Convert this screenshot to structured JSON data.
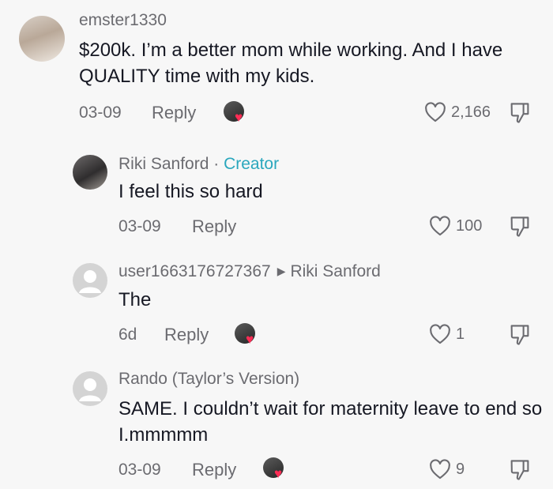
{
  "comments": [
    {
      "username": "emster1330",
      "text": "$200k. I’m a better mom while working. And I have QUALITY time with my kids.",
      "date": "03-09",
      "reply_label": "Reply",
      "likes": "2,166"
    },
    {
      "username": "Riki Sanford",
      "badge_sep": " · ",
      "badge": "Creator",
      "text": "I feel this so hard",
      "date": "03-09",
      "reply_label": "Reply",
      "likes": "100"
    },
    {
      "username": "user1663176727367",
      "reply_to": "Riki Sanford",
      "text": "The",
      "date": "6d",
      "reply_label": "Reply",
      "likes": "1"
    },
    {
      "username": "Rando (Taylor’s Version)",
      "text": "SAME. I couldn’t wait for maternity leave to end so I.mmmmm",
      "date": "03-09",
      "reply_label": "Reply",
      "likes": "9"
    }
  ],
  "colors": {
    "text": "#161823",
    "secondary": "#6b6b70",
    "creator": "#2aa7bd",
    "heart": "#fe2c55"
  },
  "icons": {
    "like": "heart-outline-icon",
    "dislike": "thumbs-down-icon",
    "creator_liked": "creator-liked-badge"
  }
}
